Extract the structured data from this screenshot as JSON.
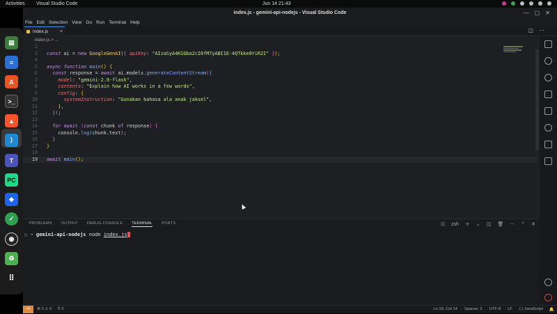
{
  "topbar": {
    "activities": "Activities",
    "app_name": "Visual Studio Code",
    "clock": "Jun 14  21:43"
  },
  "window": {
    "title": "index.js - gemini-api-nodejs - Visual Studio Code",
    "controls": [
      "—",
      "▢",
      "✕"
    ]
  },
  "menu": [
    "File",
    "Edit",
    "Selection",
    "View",
    "Go",
    "Run",
    "Terminal",
    "Help"
  ],
  "tab": {
    "label": "index.js",
    "close": "×"
  },
  "breadcrumb": "index.js > ...",
  "code_lines": [
    {
      "n": "2",
      "text": ""
    },
    {
      "n": "3",
      "text": "const ai = new GoogleGenAI({ apiKey: \"AIzaSyA4KSGba2cI6fM7yABI1E-4QTkke0YiR2I\" });"
    },
    {
      "n": "4",
      "text": ""
    },
    {
      "n": "5",
      "text": "async function main() {"
    },
    {
      "n": "6",
      "text": "  const response = await ai.models.generateContentStream({"
    },
    {
      "n": "7",
      "text": "    model: \"gemini-2.0-flash\","
    },
    {
      "n": "8",
      "text": "    contents: \"Explain how AI works in a few words\","
    },
    {
      "n": "9",
      "text": "    config: {"
    },
    {
      "n": "10",
      "text": "      systemInstruction: \"Gunakan bahasa ala anak jaksel\","
    },
    {
      "n": "11",
      "text": "    },"
    },
    {
      "n": "12",
      "text": "  });"
    },
    {
      "n": "13",
      "text": ""
    },
    {
      "n": "14",
      "text": "  for await (const chunk of response) {"
    },
    {
      "n": "15",
      "text": "    console.log(chunk.text);"
    },
    {
      "n": "16",
      "text": "  }"
    },
    {
      "n": "17",
      "text": "}"
    },
    {
      "n": "18",
      "text": ""
    },
    {
      "n": "19",
      "text": "await main();"
    }
  ],
  "panel": {
    "tabs": [
      "PROBLEMS",
      "OUTPUT",
      "DEBUG CONSOLE",
      "TERMINAL",
      "PORTS"
    ],
    "active_tab": "TERMINAL",
    "shell": "zsh",
    "terminal": {
      "prompt_symbol": "○ ➜",
      "dir": "gemini-api-nodejs",
      "command": "node",
      "arg": "index.js"
    }
  },
  "status": {
    "errors": "⊗ 0 ⚠ 0",
    "ports": "⚲ 0",
    "position": "Ln 19, Col 14",
    "spaces": "Spaces: 2",
    "encoding": "UTF-8",
    "eol": "LF",
    "language": "{ } JavaScript"
  },
  "colors": {
    "accent": "#4a8fe6",
    "background": "#1e1f22",
    "string": "#c3e88d",
    "keyword": "#c792ea"
  }
}
